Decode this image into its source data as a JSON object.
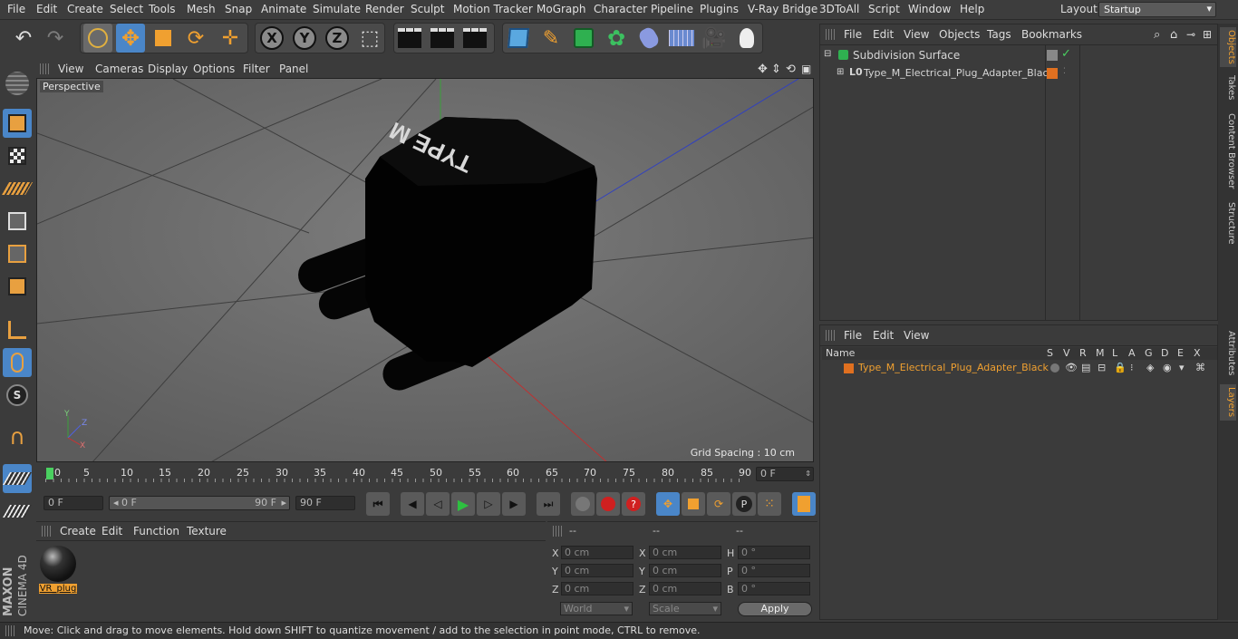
{
  "menubar": {
    "items": [
      "File",
      "Edit",
      "Create",
      "Select",
      "Tools",
      "Mesh",
      "Snap",
      "Animate",
      "Simulate",
      "Render",
      "Sculpt",
      "Motion Tracker",
      "MoGraph",
      "Character",
      "Pipeline",
      "Plugins",
      "V-Ray Bridge",
      "3DToAll",
      "Script",
      "Window",
      "Help"
    ],
    "layout_label": "Layout:",
    "layout_value": "Startup"
  },
  "viewport": {
    "menu": [
      "View",
      "Cameras",
      "Display",
      "Options",
      "Filter",
      "Panel"
    ],
    "camera_label": "Perspective",
    "grid_spacing": "Grid Spacing : 10 cm",
    "model_text": "TYPE M"
  },
  "timeline": {
    "ticks": [
      "0",
      "5",
      "10",
      "15",
      "20",
      "25",
      "30",
      "35",
      "40",
      "45",
      "50",
      "55",
      "60",
      "65",
      "70",
      "75",
      "80",
      "85",
      "90"
    ],
    "current_frame": "0 F"
  },
  "transport": {
    "start_field": "0 F",
    "range_start": "0 F",
    "range_end": "90 F",
    "end_field": "90 F"
  },
  "material_panel": {
    "menu": [
      "Create",
      "Edit",
      "Function",
      "Texture"
    ],
    "material_name": "VR_plug"
  },
  "coord_panel": {
    "headers": [
      "--",
      "--",
      "--"
    ],
    "rows": [
      {
        "a": "X",
        "av": "0 cm",
        "b": "X",
        "bv": "0 cm",
        "c": "H",
        "cv": "0 °"
      },
      {
        "a": "Y",
        "av": "0 cm",
        "b": "Y",
        "bv": "0 cm",
        "c": "P",
        "cv": "0 °"
      },
      {
        "a": "Z",
        "av": "0 cm",
        "b": "Z",
        "bv": "0 cm",
        "c": "B",
        "cv": "0 °"
      }
    ],
    "world": "World",
    "scale": "Scale",
    "apply": "Apply"
  },
  "object_panel": {
    "menu": [
      "File",
      "Edit",
      "View",
      "Objects",
      "Tags",
      "Bookmarks"
    ],
    "objects": [
      "Subdivision Surface",
      "Type_M_Electrical_Plug_Adapter_Black"
    ]
  },
  "layer_panel": {
    "menu": [
      "File",
      "Edit",
      "View"
    ],
    "columns": [
      "Name",
      "S",
      "V",
      "R",
      "M",
      "L",
      "A",
      "G",
      "D",
      "E",
      "X"
    ],
    "layer_name": "Type_M_Electrical_Plug_Adapter_Black"
  },
  "side_tabs": [
    "Objects",
    "Takes",
    "Content Browser",
    "Structure",
    "Attributes",
    "Layers"
  ],
  "status": "Move: Click and drag to move elements. Hold down SHIFT to quantize movement / add to the selection in point mode, CTRL to remove.",
  "brand": {
    "line1": "MAXON",
    "line2": "CINEMA 4D"
  },
  "colors": {
    "accent": "#f0a030",
    "layer_orange": "#e07020",
    "selected_blue": "#4a90d0"
  }
}
